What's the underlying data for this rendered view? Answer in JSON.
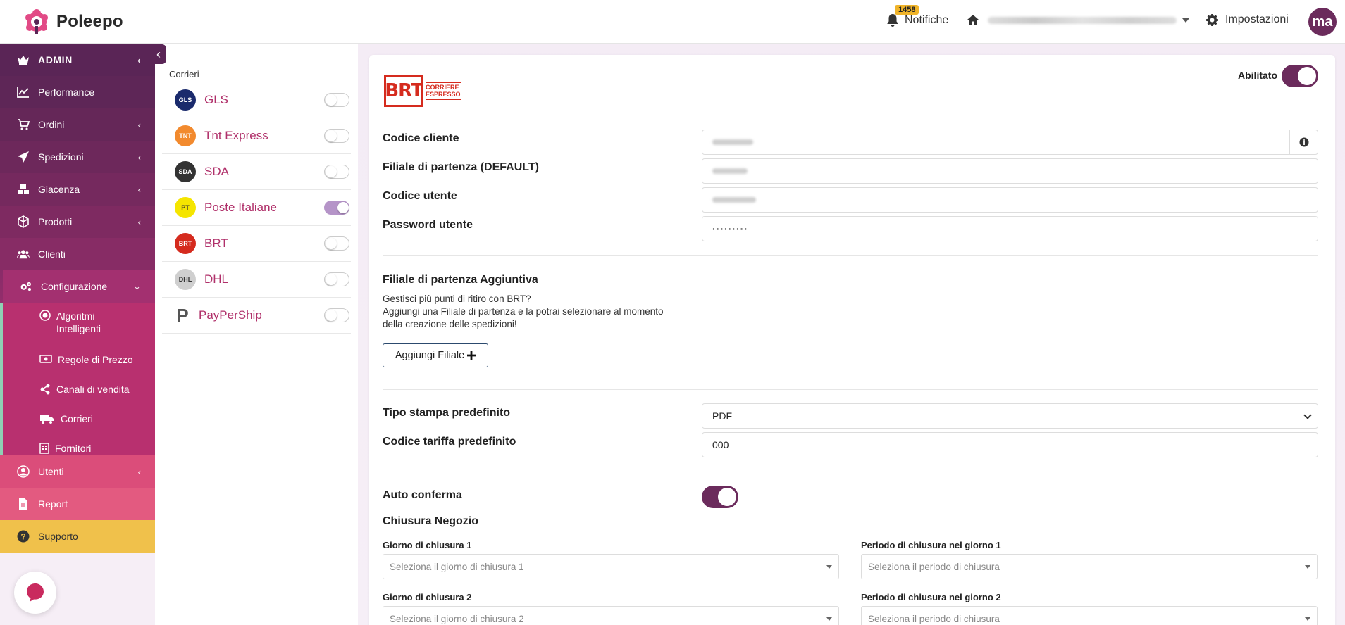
{
  "app": {
    "name": "Poleepo"
  },
  "header": {
    "notifications_label": "Notifiche",
    "notifications_count": "1458",
    "settings_label": "Impostazioni",
    "avatar_initials": "ma"
  },
  "sidebar": {
    "admin_label": "ADMIN",
    "items": [
      {
        "label": "Performance",
        "icon": "chart-line-icon"
      },
      {
        "label": "Ordini",
        "icon": "cart-icon"
      },
      {
        "label": "Spedizioni",
        "icon": "paper-plane-icon"
      },
      {
        "label": "Giacenza",
        "icon": "boxes-icon"
      },
      {
        "label": "Prodotti",
        "icon": "cube-icon"
      },
      {
        "label": "Clienti",
        "icon": "users-icon"
      },
      {
        "label": "Configurazione",
        "icon": "gears-icon"
      }
    ],
    "sub_items": [
      {
        "label": "Algoritmi Intelligenti",
        "icon": "target-icon"
      },
      {
        "label": "Regole di Prezzo",
        "icon": "money-icon"
      },
      {
        "label": "Canali di vendita",
        "icon": "share-icon"
      },
      {
        "label": "Corrieri",
        "icon": "truck-icon"
      },
      {
        "label": "Fornitori",
        "icon": "building-icon"
      }
    ],
    "utenti_label": "Utenti",
    "report_label": "Report",
    "supporto_label": "Supporto"
  },
  "carriers": {
    "title": "Corrieri",
    "items": [
      {
        "name": "GLS",
        "enabled": false,
        "logo_color": "#1a2a6c",
        "logo_text": "GLS"
      },
      {
        "name": "Tnt Express",
        "enabled": false,
        "logo_color": "#f28a2e",
        "logo_text": "TNT"
      },
      {
        "name": "SDA",
        "enabled": false,
        "logo_color": "#333333",
        "logo_text": "SDA"
      },
      {
        "name": "Poste Italiane",
        "enabled": true,
        "logo_color": "#f5e500",
        "logo_text": "PT"
      },
      {
        "name": "BRT",
        "enabled": false,
        "logo_color": "#d52b1e",
        "logo_text": "BRT"
      },
      {
        "name": "DHL",
        "enabled": false,
        "logo_color": "#cfcfcf",
        "logo_text": "DHL"
      },
      {
        "name": "PayPerShip",
        "enabled": false,
        "logo_color": "#ffffff",
        "logo_text": "P"
      }
    ]
  },
  "form": {
    "brt_logo_main": "BRT",
    "brt_logo_side_1": "CORRIERE",
    "brt_logo_side_2": "ESPRESSO",
    "enabled_label": "Abilitato",
    "codice_cliente_label": "Codice cliente",
    "filiale_default_label": "Filiale di partenza (DEFAULT)",
    "codice_utente_label": "Codice utente",
    "password_label": "Password utente",
    "password_value": "·········",
    "filiale_aggiuntiva_title": "Filiale di partenza Aggiuntiva",
    "filiale_help_1": "Gestisci più punti di ritiro con BRT?",
    "filiale_help_2": "Aggiungi una Filiale di partenza e la potrai selezionare al momento della creazione delle spedizioni!",
    "aggiungi_filiale_label": "Aggiungi Filiale",
    "tipo_stampa_label": "Tipo stampa predefinito",
    "tipo_stampa_value": "PDF",
    "codice_tariffa_label": "Codice tariffa predefinito",
    "codice_tariffa_value": "000",
    "auto_conferma_label": "Auto conferma",
    "auto_conferma_enabled": true,
    "chiusura_title": "Chiusura Negozio",
    "giorno1_label": "Giorno di chiusura 1",
    "giorno1_placeholder": "Seleziona il giorno di chiusura 1",
    "periodo1_label": "Periodo di chiusura nel giorno 1",
    "periodo1_placeholder": "Seleziona il periodo di chiusura",
    "giorno2_label": "Giorno di chiusura 2",
    "giorno2_placeholder": "Seleziona il giorno di chiusura 2",
    "periodo2_label": "Periodo di chiusura nel giorno 2",
    "periodo2_placeholder": "Seleziona il periodo di chiusura"
  }
}
